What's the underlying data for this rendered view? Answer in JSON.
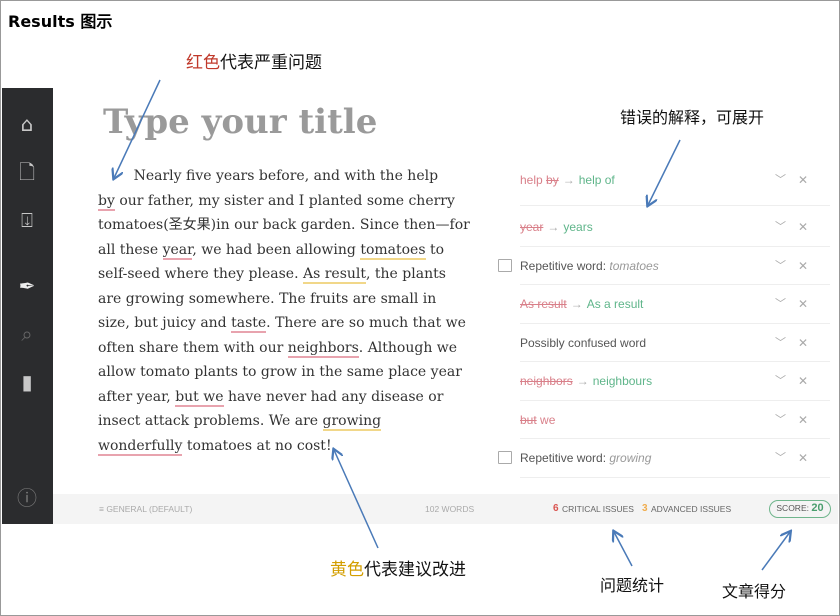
{
  "heading": "Results 图示",
  "annotations": {
    "red_key": "红色",
    "red_rest": "代表严重问题",
    "explain": "错误的解释，可展开",
    "yellow_key": "黄色",
    "yellow_rest": "代表建议改进",
    "stats": "问题统计",
    "score": "文章得分"
  },
  "sidebar": {
    "icons": [
      "home-icon",
      "document-icon",
      "download-icon",
      "pen-icon",
      "search-doc-icon",
      "book-icon",
      "help-icon"
    ]
  },
  "editor": {
    "title": "Type your title",
    "lines": [
      [
        {
          "t": "        Nearly five years before, and with the help"
        }
      ],
      [
        {
          "t": "by",
          "u": "red"
        },
        {
          "t": " our father, my sister and I planted some cherry"
        }
      ],
      [
        {
          "t": "tomatoes(圣女果)in our back garden. Since then—for"
        }
      ],
      [
        {
          "t": "all these "
        },
        {
          "t": "year",
          "u": "red"
        },
        {
          "t": ", we had been allowing "
        },
        {
          "t": "tomatoes",
          "u": "yel"
        },
        {
          "t": " to"
        }
      ],
      [
        {
          "t": "self-seed where they please. "
        },
        {
          "t": "As result",
          "u": "yel"
        },
        {
          "t": ", the plants"
        }
      ],
      [
        {
          "t": "are growing somewhere. The fruits are small in"
        }
      ],
      [
        {
          "t": "size, but juicy and "
        },
        {
          "t": "taste",
          "u": "red"
        },
        {
          "t": ". There are so much that we"
        }
      ],
      [
        {
          "t": "often share them with our "
        },
        {
          "t": "neighbors",
          "u": "red"
        },
        {
          "t": ". Although we"
        }
      ],
      [
        {
          "t": "allow tomato plants to grow in the same place year"
        }
      ],
      [
        {
          "t": "after year, "
        },
        {
          "t": "but we",
          "u": "red"
        },
        {
          "t": " have never had any disease or"
        }
      ],
      [
        {
          "t": "insect attack problems. We are "
        },
        {
          "t": "growing",
          "u": "yel"
        }
      ],
      [
        {
          "t": "wonderfully",
          "u": "red"
        },
        {
          "t": " tomatoes at no cost!"
        }
      ]
    ]
  },
  "issues": [
    {
      "plain": "help ",
      "del": "by",
      "ins": "help of"
    },
    {
      "del": "year",
      "ins": "years"
    },
    {
      "icon": "book-icon",
      "label": "Repetitive word: ",
      "word": "tomatoes"
    },
    {
      "del": "As result",
      "ins": "As a result"
    },
    {
      "label": "Possibly confused word"
    },
    {
      "del": "neighbors",
      "ins": "neighbours"
    },
    {
      "del": "but",
      "red": " we"
    },
    {
      "icon": "book-icon",
      "label": "Repetitive word: ",
      "word": "growing"
    }
  ],
  "footer": {
    "mode": "≡ GENERAL (DEFAULT)",
    "words": "102 WORDS",
    "critical_count": "6",
    "critical_label": "CRITICAL ISSUES",
    "advanced_count": "3",
    "advanced_label": "ADVANCED ISSUES",
    "score_label": "SCORE: ",
    "score_value": "20"
  },
  "colors": {
    "critical": "#d9534f",
    "advanced": "#f0ad4e",
    "correct": "#5fb58a",
    "arrow": "#4a7ab8"
  }
}
